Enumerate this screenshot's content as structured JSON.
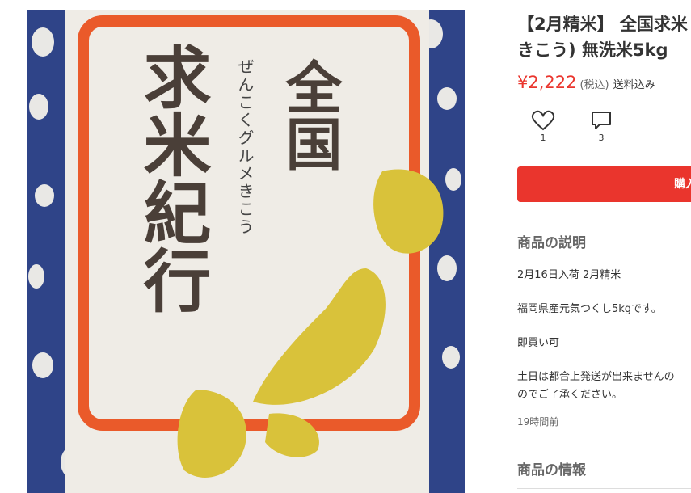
{
  "product": {
    "title_line1": "【2月精米】 全国求米",
    "title_line2": "きこう) 無洗米5kg",
    "price": "¥2,222",
    "tax_label": "(税込)",
    "shipping": "送料込み",
    "like_count": "1",
    "comment_count": "3",
    "buy_label": "購入"
  },
  "photo": {
    "bag_text_main": "全国求米紀行",
    "bag_text_ruby": "ぜんこくグルメきこう"
  },
  "description": {
    "heading": "商品の説明",
    "line1": "2月16日入荷 2月精米",
    "line2": "福岡県産元気つくし5kgです。",
    "line3": "即買い可",
    "line4a": "土日は都合上発送が出来ませんの",
    "line4b": "のでご了承ください。",
    "posted": "19時間前"
  },
  "info": {
    "heading": "商品の情報"
  },
  "colors": {
    "accent": "#ea352d",
    "bag_blue": "#33468a",
    "bag_frame": "#ea5a2a",
    "bag_gold": "#d9c23a"
  }
}
